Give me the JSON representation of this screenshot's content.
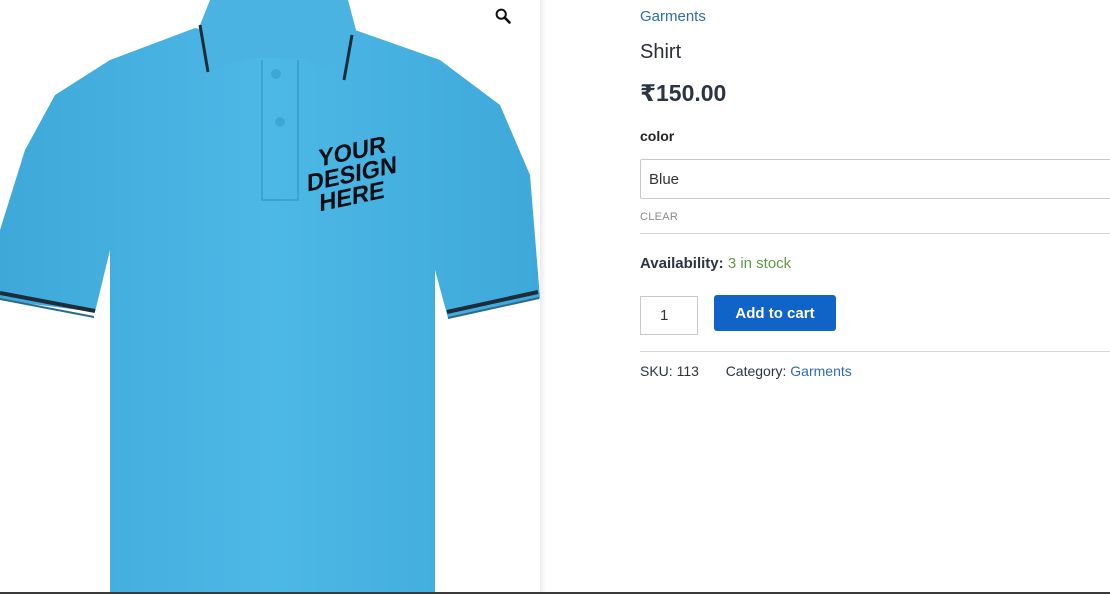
{
  "product": {
    "breadcrumb_category": "Garments",
    "title": "Shirt",
    "price": "₹150.00",
    "attribute_label": "color",
    "selected_color": "Blue",
    "clear_label": "CLEAR",
    "availability_label": "Availability:",
    "availability_value": "3 in stock",
    "quantity": "1",
    "add_to_cart_label": "Add to cart",
    "sku_label": "SKU:",
    "sku_value": "113",
    "category_label": "Category:",
    "category_value": "Garments"
  },
  "image": {
    "print_text_line1": "YOUR",
    "print_text_line2": "DESIGN",
    "print_text_line3": "HERE",
    "shirt_color": "#4bb6e3"
  },
  "icons": {
    "zoom": "zoom-magnifier-icon"
  },
  "colors": {
    "link": "#2e6ab7",
    "button": "#1164c7",
    "in_stock": "#5f9a45"
  }
}
